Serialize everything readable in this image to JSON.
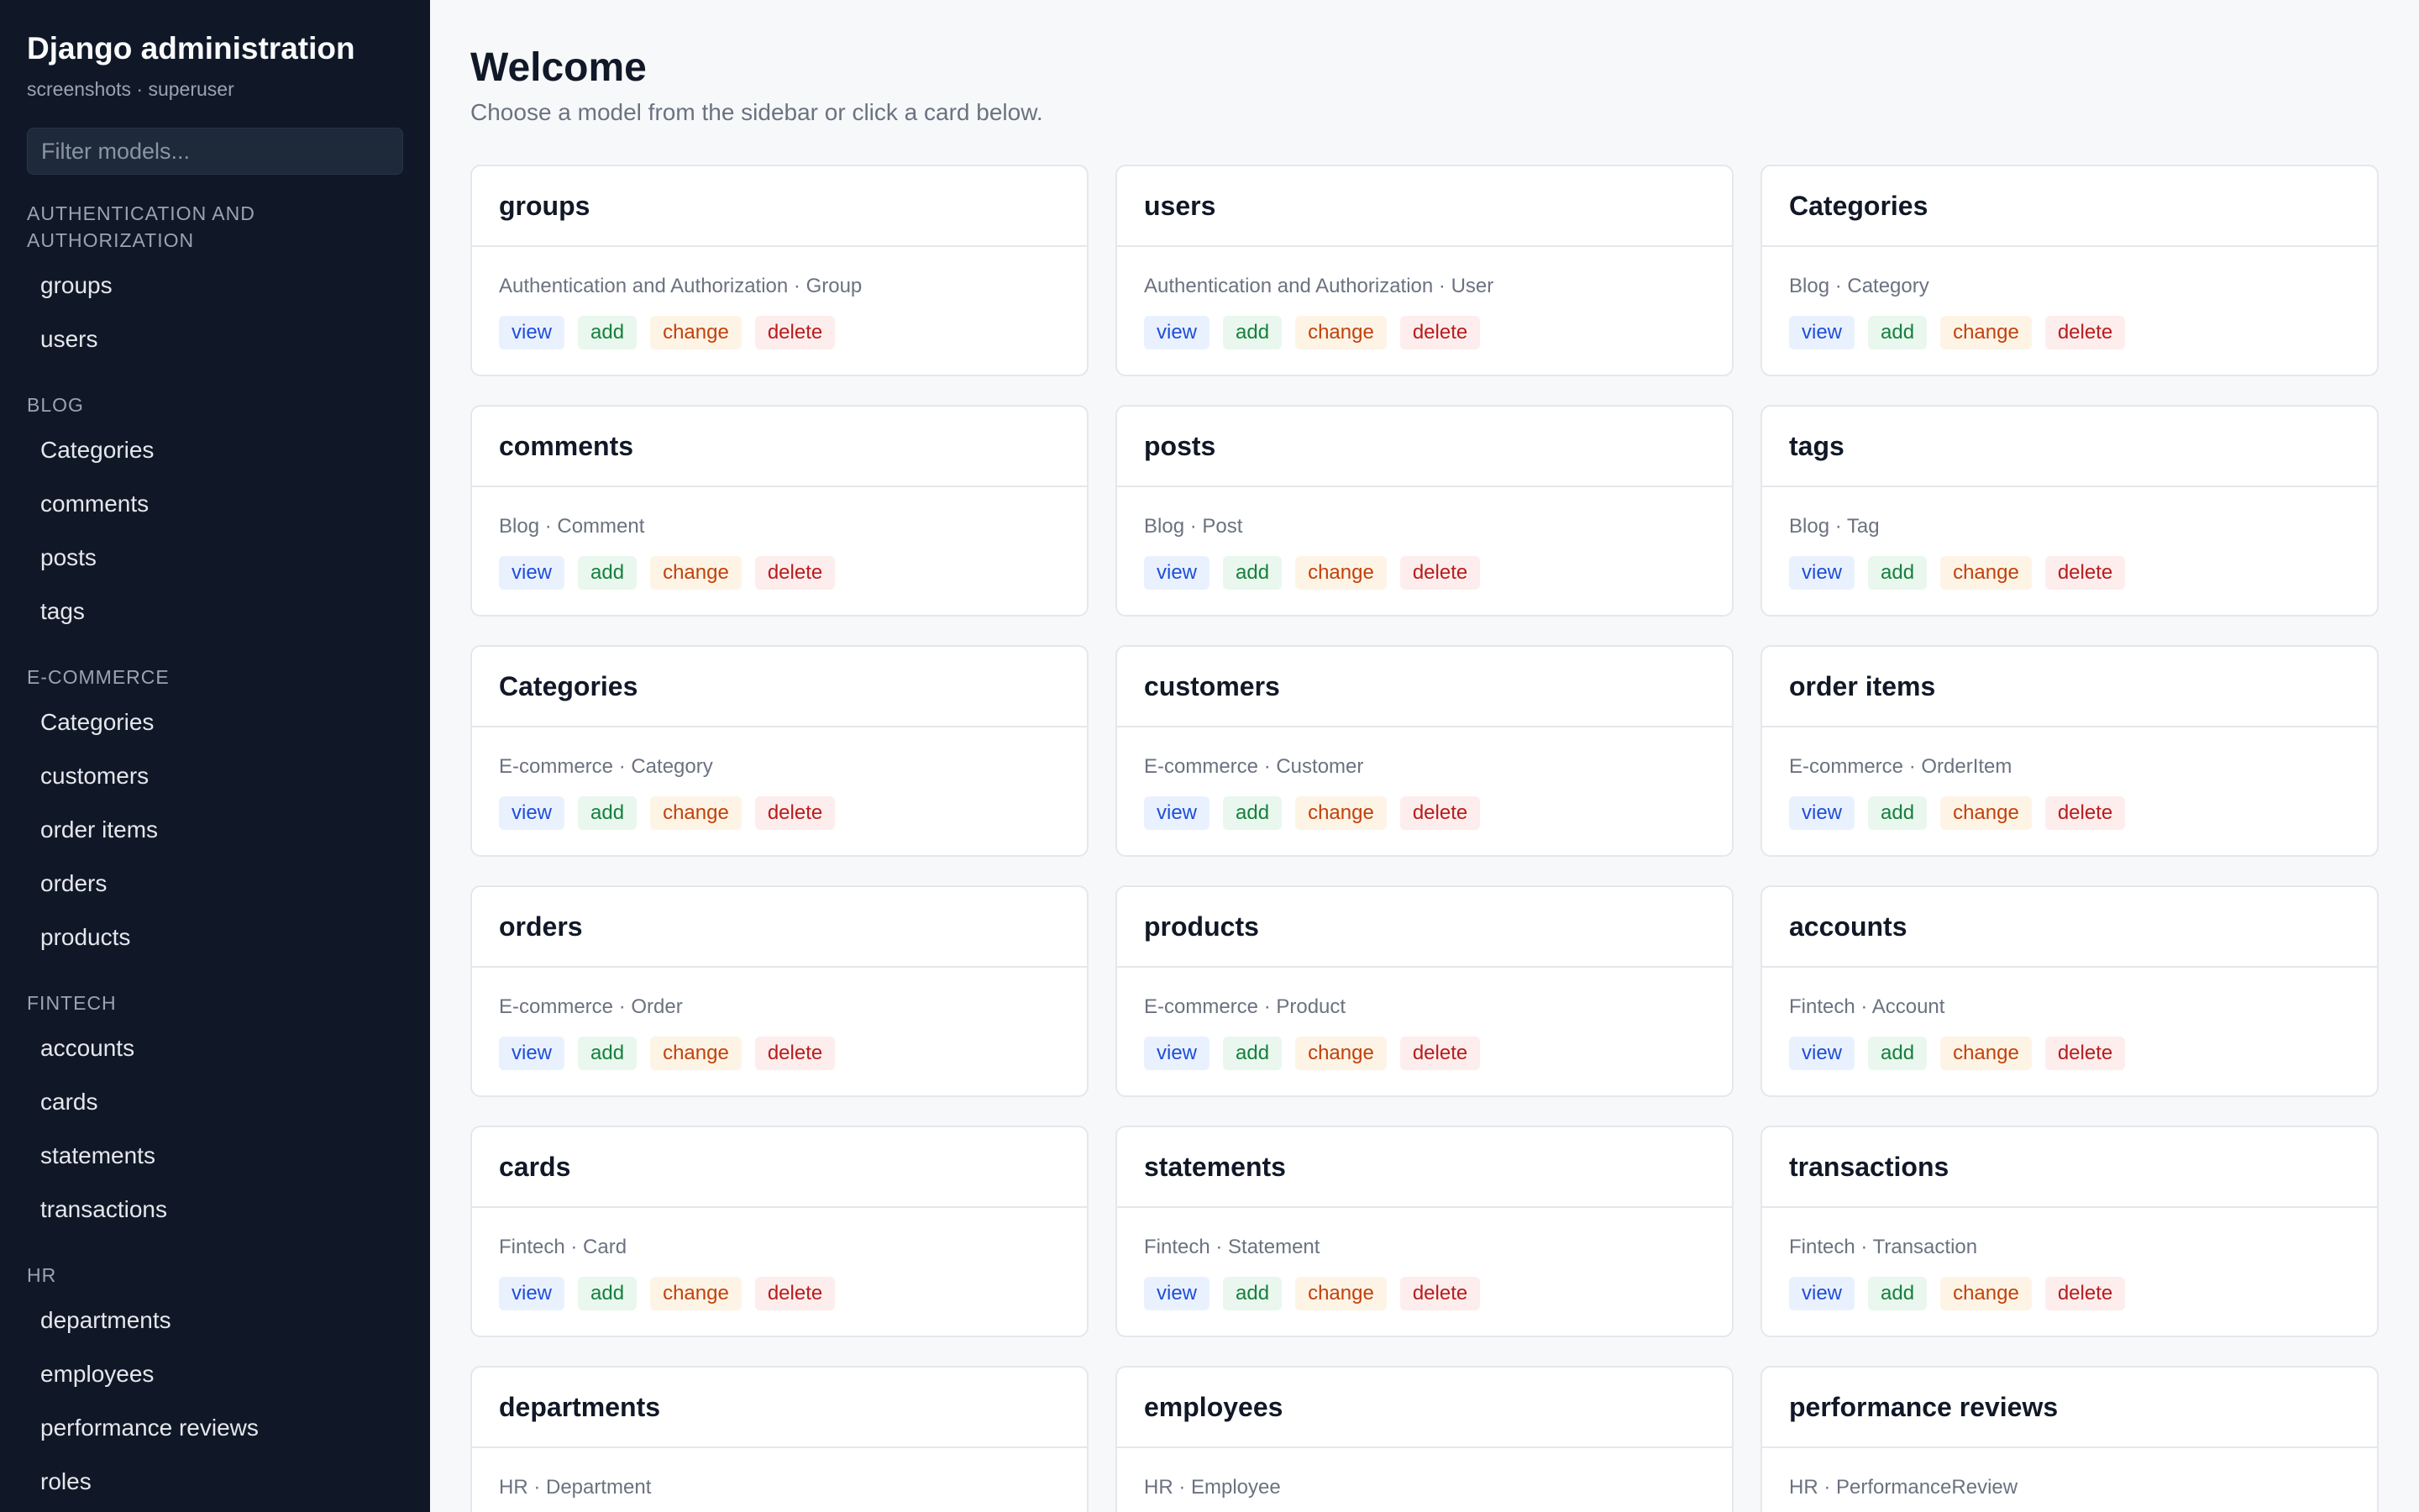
{
  "sidebar": {
    "title": "Django administration",
    "subtitle": "screenshots · superuser",
    "filter_placeholder": "Filter models...",
    "groups": [
      {
        "title": "AUTHENTICATION AND AUTHORIZATION",
        "items": [
          "groups",
          "users"
        ]
      },
      {
        "title": "BLOG",
        "items": [
          "Categories",
          "comments",
          "posts",
          "tags"
        ]
      },
      {
        "title": "E-COMMERCE",
        "items": [
          "Categories",
          "customers",
          "order items",
          "orders",
          "products"
        ]
      },
      {
        "title": "FINTECH",
        "items": [
          "accounts",
          "cards",
          "statements",
          "transactions"
        ]
      },
      {
        "title": "HR",
        "items": [
          "departments",
          "employees",
          "performance reviews",
          "roles"
        ]
      }
    ]
  },
  "main": {
    "title": "Welcome",
    "subtitle": "Choose a model from the sidebar or click a card below.",
    "action_labels": {
      "view": "view",
      "add": "add",
      "change": "change",
      "delete": "delete"
    },
    "cards": [
      {
        "title": "groups",
        "meta": "Authentication and Authorization · Group"
      },
      {
        "title": "users",
        "meta": "Authentication and Authorization · User"
      },
      {
        "title": "Categories",
        "meta": "Blog · Category"
      },
      {
        "title": "comments",
        "meta": "Blog · Comment"
      },
      {
        "title": "posts",
        "meta": "Blog · Post"
      },
      {
        "title": "tags",
        "meta": "Blog · Tag"
      },
      {
        "title": "Categories",
        "meta": "E-commerce · Category"
      },
      {
        "title": "customers",
        "meta": "E-commerce · Customer"
      },
      {
        "title": "order items",
        "meta": "E-commerce · OrderItem"
      },
      {
        "title": "orders",
        "meta": "E-commerce · Order"
      },
      {
        "title": "products",
        "meta": "E-commerce · Product"
      },
      {
        "title": "accounts",
        "meta": "Fintech · Account"
      },
      {
        "title": "cards",
        "meta": "Fintech · Card"
      },
      {
        "title": "statements",
        "meta": "Fintech · Statement"
      },
      {
        "title": "transactions",
        "meta": "Fintech · Transaction"
      },
      {
        "title": "departments",
        "meta": "HR · Department"
      },
      {
        "title": "employees",
        "meta": "HR · Employee"
      },
      {
        "title": "performance reviews",
        "meta": "HR · PerformanceReview"
      }
    ]
  }
}
